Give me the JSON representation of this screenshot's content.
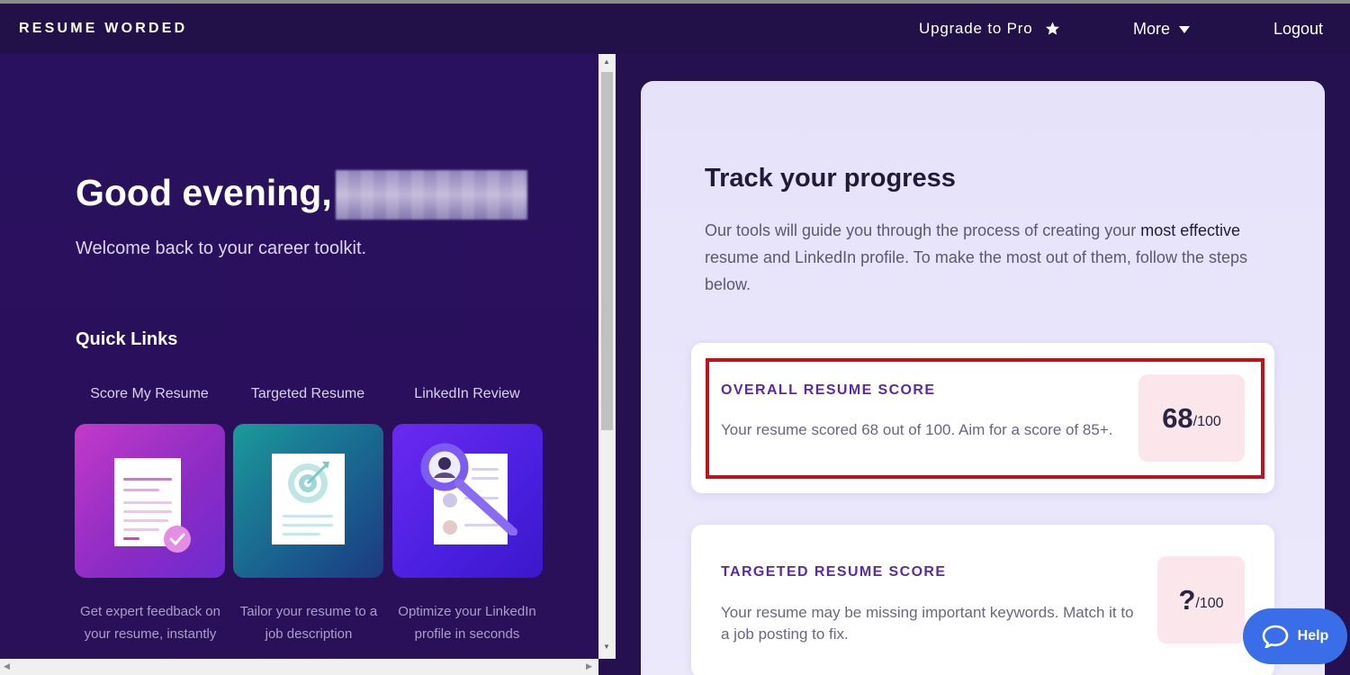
{
  "header": {
    "brand": "RESUME WORDED",
    "upgrade_label": "Upgrade to Pro",
    "more_label": "More",
    "logout_label": "Logout"
  },
  "left": {
    "greeting": "Good evening,",
    "welcome": "Welcome back to your career toolkit.",
    "quick_links_title": "Quick Links",
    "quick_links": [
      {
        "label": "Score My Resume",
        "description": "Get expert feedback on your resume, instantly"
      },
      {
        "label": "Targeted Resume",
        "description": "Tailor your resume to a job description"
      },
      {
        "label": "LinkedIn Review",
        "description": "Optimize your LinkedIn profile in seconds"
      }
    ]
  },
  "right": {
    "title": "Track your progress",
    "desc_part1": "Our tools will guide you through the process of creating your ",
    "desc_bold1": "most effective",
    "desc_part2": " resume and LinkedIn profile. To make the most out of them, follow the steps below.",
    "scores": [
      {
        "label": "OVERALL RESUME SCORE",
        "text": "Your resume scored 68 out of 100. Aim for a score of 85+.",
        "value": "68",
        "out_of": "/100"
      },
      {
        "label": "TARGETED RESUME SCORE",
        "text": "Your resume may be missing important keywords. Match it to a job posting to fix.",
        "value": "?",
        "out_of": "/100"
      }
    ]
  },
  "help": {
    "label": "Help"
  },
  "colors": {
    "background": "#261150",
    "accent_purple": "#5a2ba4",
    "highlight_red": "#c0141c",
    "help_blue": "#3a6ee8",
    "score_box_pink": "#fbe6ec"
  }
}
